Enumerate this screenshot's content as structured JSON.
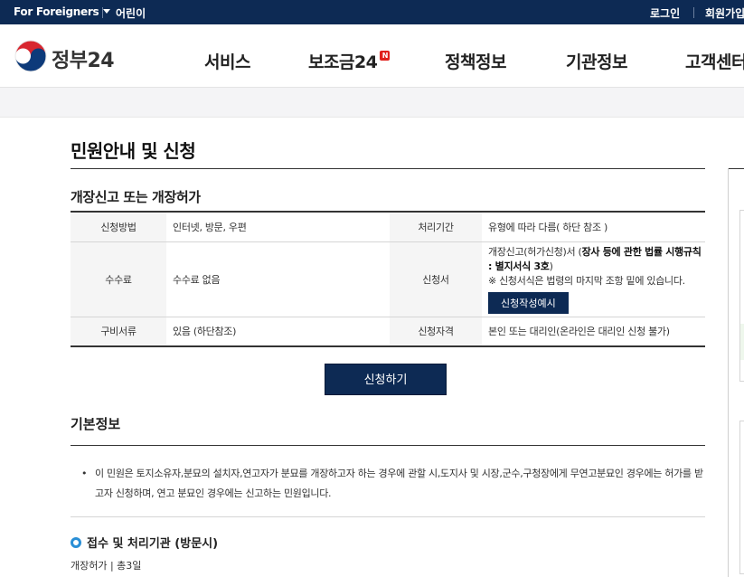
{
  "topbar": {
    "lang_label": "For Foreigners",
    "kids_label": "어린이",
    "login_label": "로그인",
    "join_label": "회원가입"
  },
  "header": {
    "logo_text": "정부24",
    "nav": [
      "서비스",
      "보조금24",
      "정책정보",
      "기관정보",
      "고객센터"
    ],
    "new_badge": "N"
  },
  "page": {
    "title": "민원안내 및 신청",
    "subtitle": "개장신고 또는 개장허가"
  },
  "info_table": {
    "method_label": "신청방법",
    "method_value": "인터넷, 방문, 우편",
    "period_label": "처리기간",
    "period_value": "유형에 따라 다름( 하단 참조 )",
    "fee_label": "수수료",
    "fee_value": "수수료 없음",
    "form_label": "신청서",
    "form_value_pre": "개장신고(허가신청)서 (",
    "form_value_bold": "장사 등에 관한 법률 시행규칙 : 별지서식 3호",
    "form_value_post": ")",
    "form_note": "※ 신청서식은 법령의 마지막 조항 밑에 있습니다.",
    "sample_button": "신청작성예시",
    "docs_label": "구비서류",
    "docs_value": "있음 (하단참조)",
    "qual_label": "신청자격",
    "qual_value": "본인 또는 대리인(온라인은 대리인 신청 불가)"
  },
  "apply_button": "신청하기",
  "basic": {
    "title": "기본정보",
    "bullet": "•",
    "text": "이 민원은 토지소유자,분묘의 설치자,연고자가 분묘를 개장하고자 하는 경우에 관할 시,도지사 및 시장,군수,구청장에게 무연고분묘인 경우에는 허가를 받고자 신청하며, 연고 분묘인 경우에는 신고하는 민원입니다."
  },
  "processing": {
    "title": "접수 및 처리기관 (방문시)",
    "sub": "개장허가 | 총3일"
  },
  "colors": {
    "navy": "#0d2a54",
    "accent_blue": "#2a8fd6",
    "badge_red": "#e0201b"
  }
}
